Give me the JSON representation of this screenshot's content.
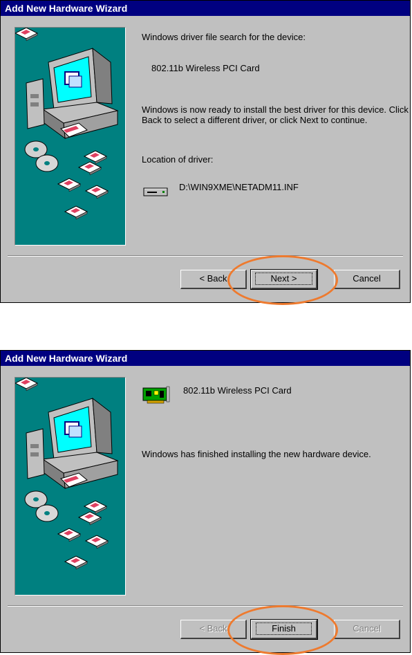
{
  "dialog1": {
    "title": "Add New Hardware Wizard",
    "heading": "Windows driver file search for the device:",
    "device_name": "802.11b Wireless PCI Card",
    "message": "Windows is now ready to install the best driver for this device. Click Back to select a different driver, or click Next to continue.",
    "location_label": "Location of driver:",
    "driver_path": "D:\\WIN9XME\\NETADM11.INF",
    "back_label": "< Back",
    "next_label": "Next >",
    "cancel_label": "Cancel"
  },
  "dialog2": {
    "title": "Add New Hardware Wizard",
    "device_name": "802.11b Wireless PCI Card",
    "message": "Windows has finished installing the new hardware device.",
    "back_label": "< Back",
    "finish_label": "Finish",
    "cancel_label": "Cancel"
  },
  "colors": {
    "title_bar": "#000080",
    "art_bg": "#008080",
    "highlight_circle": "#ee7a2e"
  }
}
